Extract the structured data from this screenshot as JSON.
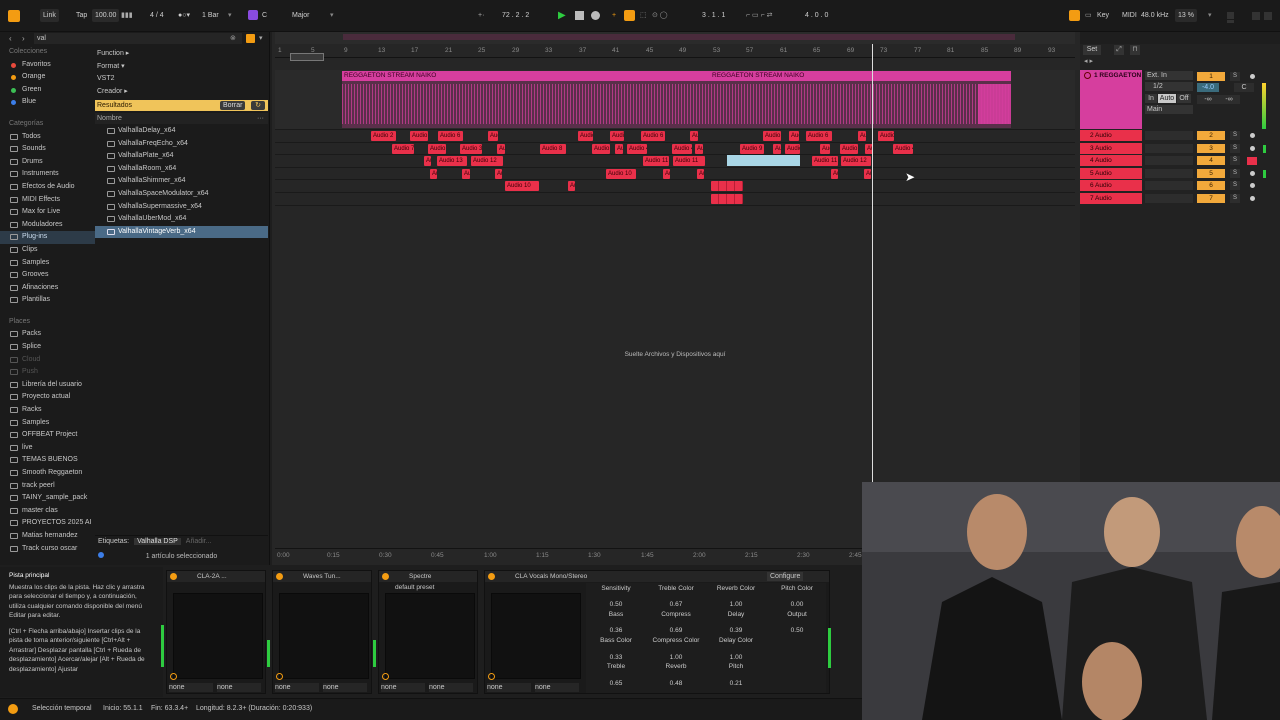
{
  "transport": {
    "link": "Link",
    "tap": "Tap",
    "tempo": "100.00",
    "time_sig": "4 / 4",
    "quantize": "1 Bar",
    "key": "C",
    "scale": "Major",
    "position": "72 .  2 .  2",
    "loop_start": "3 .  1 .  1",
    "loop_len": "4 .  0 .  0",
    "key_btn": "Key",
    "midi_btn": "MIDI",
    "sample_rate": "48.0 kHz",
    "cpu": "13 %"
  },
  "browser": {
    "search_value": "val",
    "collections_heading": "Colecciones",
    "collections": [
      {
        "label": "Favoritos",
        "color": "#e84a3c"
      },
      {
        "label": "Orange",
        "color": "#f39c12"
      },
      {
        "label": "Green",
        "color": "#3cbf55"
      },
      {
        "label": "Blue",
        "color": "#3c7ee8"
      }
    ],
    "categories_heading": "Categorías",
    "categories": [
      "Todos",
      "Sounds",
      "Drums",
      "Instruments",
      "Efectos de Audio",
      "MIDI Effects",
      "Max for Live",
      "Moduladores",
      "Plug-ins",
      "Clips",
      "Samples",
      "Grooves",
      "Afinaciones",
      "Plantillas"
    ],
    "selected_category": "Plug-ins",
    "places_heading": "Places",
    "places": [
      "Packs",
      "Splice",
      "Cloud",
      "Push",
      "Librería del usuario",
      "Proyecto actual",
      "Racks",
      "Samples",
      "OFFBEAT Project",
      "live",
      "TEMAS BUENOS",
      "Smooth Reggaeton",
      "track peerl",
      "TAINY_sample_pack",
      "master clas",
      "PROYECTOS 2025 AI",
      "Matias hernandez",
      "Track curso oscar"
    ],
    "filters": [
      "Function ▸",
      "Format ▾",
      "VST2",
      "Creador ▸"
    ],
    "results_label": "Resultados",
    "clear_label": "Borrar",
    "name_column": "Nombre",
    "results": [
      "ValhallaDelay_x64",
      "ValhallaFreqEcho_x64",
      "ValhallaPlate_x64",
      "ValhallaRoom_x64",
      "ValhallaShimmer_x64",
      "ValhallaSpaceModulator_x64",
      "ValhallaSupermassive_x64",
      "ValhallaUberMod_x64",
      "ValhallaVintageVerb_x64"
    ],
    "selected_result": "ValhallaVintageVerb_x64",
    "tags_label": "Etiquetas:",
    "tag_value": "Valhalla DSP",
    "tag_add": "Añadir...",
    "selected_count": "1 artículo seleccionado"
  },
  "arrangement": {
    "bar_numbers": [
      "1",
      "5",
      "9",
      "13",
      "17",
      "21",
      "25",
      "29",
      "33",
      "37",
      "41",
      "45",
      "49",
      "53",
      "57",
      "61",
      "65",
      "69",
      "73",
      "77",
      "81",
      "85",
      "89",
      "93"
    ],
    "time_marks": [
      "0:00",
      "0:15",
      "0:30",
      "0:45",
      "1:00",
      "1:15",
      "1:30",
      "1:45",
      "2:00",
      "2:15",
      "2:30",
      "2:45"
    ],
    "drop_hint": "Suelte Archivos y Dispositivos aquí",
    "set_label": "Set",
    "clip_title": "REGGAETON STREAM NAIKO",
    "audio_clip_labels": [
      "Audio 2",
      "Audio 3",
      "Audio 4",
      "Audio 5",
      "Audio 6",
      "Audio 7",
      "Audio 8",
      "Audio 9",
      "Audio 10",
      "Audio 11",
      "Audio 12",
      "Audio 13"
    ]
  },
  "tracks": [
    {
      "name": "1 REGGAETON",
      "num": "1"
    },
    {
      "name": "2 Audio",
      "num": "2"
    },
    {
      "name": "3 Audio",
      "num": "3"
    },
    {
      "name": "4 Audio",
      "num": "4"
    },
    {
      "name": "5 Audio",
      "num": "5"
    },
    {
      "name": "6 Audio",
      "num": "6"
    },
    {
      "name": "7 Audio",
      "num": "7"
    }
  ],
  "io": {
    "input": "Ext. In",
    "channel": "1/2",
    "in": "In",
    "auto": "Auto",
    "off": "Off",
    "main": "Main",
    "vol": "-4.0",
    "pan": "C",
    "inf": "-∞"
  },
  "track_solo": "S",
  "info": {
    "title": "Pista principal",
    "text": "Muestra los clips de la pista. Haz clic y arrastra para seleccionar el tiempo y, a continuación, utiliza cualquier comando disponible del menú Editar para editar.",
    "shortcuts": "[Ctrl + Flecha arriba/abajo] Insertar clips de la pista de toma anterior/siguiente [Ctrl+Alt + Arrastrar] Desplazar pantalla [Ctrl + Rueda de desplazamiento] Acercar/alejar [Alt + Rueda de desplazamiento] Ajustar"
  },
  "devices": [
    {
      "name": "CLA-2A ...",
      "sel1": "none",
      "sel2": "none"
    },
    {
      "name": "Waves Tun...",
      "sel1": "none",
      "sel2": "none"
    },
    {
      "name": "Spectre",
      "preset": "default preset",
      "sel1": "none",
      "sel2": "none"
    },
    {
      "name": "CLA Vocals Mono/Stereo",
      "configure": "Configure",
      "sel1": "none",
      "sel2": "none"
    }
  ],
  "cla_params": [
    {
      "label": "Sensitivity",
      "value": "0.50"
    },
    {
      "label": "Treble Color",
      "value": "0.67"
    },
    {
      "label": "Reverb Color",
      "value": "1.00"
    },
    {
      "label": "Pitch Color",
      "value": "0.00"
    },
    {
      "label": "Bass",
      "value": "0.36"
    },
    {
      "label": "Compress",
      "value": "0.69"
    },
    {
      "label": "Delay",
      "value": "0.39"
    },
    {
      "label": "Output",
      "value": "0.50"
    },
    {
      "label": "Bass Color",
      "value": "0.33"
    },
    {
      "label": "Compress Color",
      "value": "1.00"
    },
    {
      "label": "Delay Color",
      "value": "1.00"
    },
    {
      "label": "Treble",
      "value": "0.65"
    },
    {
      "label": "Reverb",
      "value": "0.48"
    },
    {
      "label": "Pitch",
      "value": "0.21"
    }
  ],
  "status": {
    "mode": "Selección temporal",
    "start": "Inicio: 55.1.1",
    "end": "Fin: 63.3.4+",
    "length": "Longitud: 8.2.3+ (Duración: 0:20:933)"
  },
  "colors": {
    "accent": "#f39c12",
    "pink": "#d63e9e",
    "red_clip": "#e9304a",
    "number": "#f2a93b"
  }
}
